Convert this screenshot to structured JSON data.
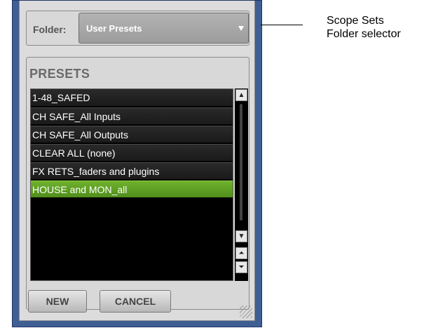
{
  "folder": {
    "label": "Folder:",
    "value": "User Presets"
  },
  "presets": {
    "title": "PRESETS",
    "items": [
      "1-48_SAFED",
      "CH SAFE_All Inputs",
      "CH SAFE_All Outputs",
      "CLEAR ALL (none)",
      "FX RETS_faders and plugins",
      "HOUSE and MON_all"
    ],
    "selected_item": "HOUSE and MON_all"
  },
  "buttons": {
    "new_label": "NEW",
    "cancel_label": "CANCEL"
  },
  "callout": {
    "line1": "Scope Sets",
    "line2": "Folder selector"
  },
  "colors": {
    "panel_frame": "#3f5f94",
    "selected_row": "#5e9e22",
    "list_bg": "#000000"
  }
}
